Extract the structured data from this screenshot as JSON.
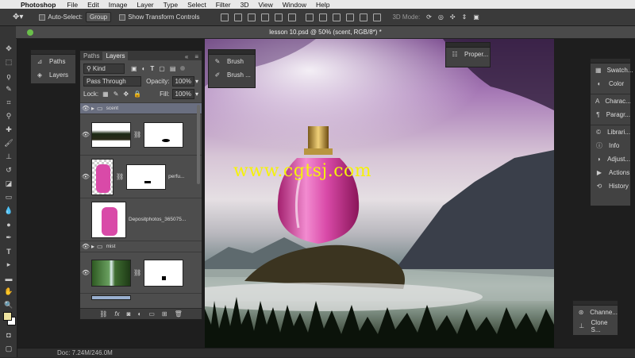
{
  "menubar": {
    "apple": "",
    "app": "Photoshop",
    "items": [
      "File",
      "Edit",
      "Image",
      "Layer",
      "Type",
      "Select",
      "Filter",
      "3D",
      "View",
      "Window",
      "Help"
    ]
  },
  "options": {
    "auto_select_label": "Auto-Select:",
    "auto_select_value": "Group",
    "transform_label": "Show Transform Controls",
    "mode_3d": "3D Mode:"
  },
  "document": {
    "tab_title": "lesson 10.psd @ 50% (scent, RGB/8*) *",
    "status": "Doc: 7.24M/246.0M"
  },
  "paths_panel": {
    "items": [
      {
        "label": "Paths"
      },
      {
        "label": "Layers"
      }
    ]
  },
  "brush_panel": {
    "items": [
      {
        "label": "Brush"
      },
      {
        "label": "Brush ..."
      }
    ]
  },
  "properties_panel": {
    "label": "Proper..."
  },
  "right_panel": {
    "items": [
      "Swatch...",
      "Color",
      "Charac...",
      "Paragr...",
      "Librari...",
      "Info",
      "Adjust...",
      "Actions",
      "History"
    ]
  },
  "channels_panel": {
    "items": [
      "Channe...",
      "Clone S..."
    ]
  },
  "layers": {
    "tabs": [
      "Paths",
      "Layers"
    ],
    "kind": "Kind",
    "blend": "Pass Through",
    "opacity_label": "Opacity:",
    "opacity": "100%",
    "lock_label": "Lock:",
    "fill_label": "Fill:",
    "fill": "100%",
    "rows": [
      {
        "name": "scent"
      },
      {
        "name": ""
      },
      {
        "name": "perfu..."
      },
      {
        "name": "Depositphotos_365075..."
      },
      {
        "name": "mist"
      },
      {
        "name": ""
      }
    ]
  },
  "watermark": "www.cgtsj.com",
  "colors": {
    "accent": "#6ac04a",
    "foreground": "#eee3a0",
    "background": "#ffffff",
    "watermark": "#f5f20b"
  }
}
